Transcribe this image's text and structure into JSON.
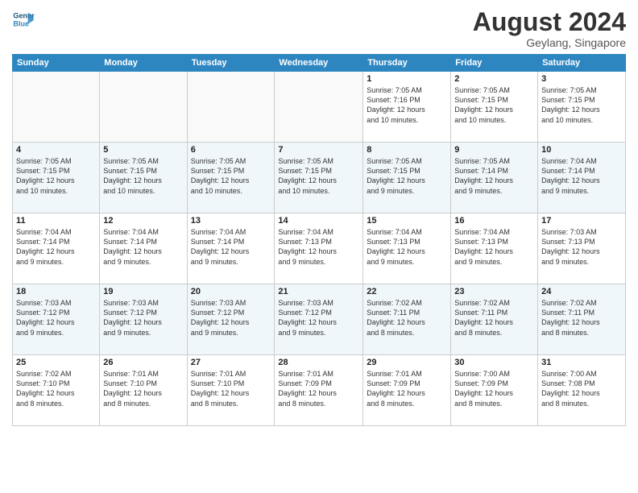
{
  "logo": {
    "line1": "General",
    "line2": "Blue"
  },
  "title": "August 2024",
  "subtitle": "Geylang, Singapore",
  "headers": [
    "Sunday",
    "Monday",
    "Tuesday",
    "Wednesday",
    "Thursday",
    "Friday",
    "Saturday"
  ],
  "weeks": [
    [
      {
        "day": "",
        "info": ""
      },
      {
        "day": "",
        "info": ""
      },
      {
        "day": "",
        "info": ""
      },
      {
        "day": "",
        "info": ""
      },
      {
        "day": "1",
        "info": "Sunrise: 7:05 AM\nSunset: 7:16 PM\nDaylight: 12 hours\nand 10 minutes."
      },
      {
        "day": "2",
        "info": "Sunrise: 7:05 AM\nSunset: 7:15 PM\nDaylight: 12 hours\nand 10 minutes."
      },
      {
        "day": "3",
        "info": "Sunrise: 7:05 AM\nSunset: 7:15 PM\nDaylight: 12 hours\nand 10 minutes."
      }
    ],
    [
      {
        "day": "4",
        "info": "Sunrise: 7:05 AM\nSunset: 7:15 PM\nDaylight: 12 hours\nand 10 minutes."
      },
      {
        "day": "5",
        "info": "Sunrise: 7:05 AM\nSunset: 7:15 PM\nDaylight: 12 hours\nand 10 minutes."
      },
      {
        "day": "6",
        "info": "Sunrise: 7:05 AM\nSunset: 7:15 PM\nDaylight: 12 hours\nand 10 minutes."
      },
      {
        "day": "7",
        "info": "Sunrise: 7:05 AM\nSunset: 7:15 PM\nDaylight: 12 hours\nand 10 minutes."
      },
      {
        "day": "8",
        "info": "Sunrise: 7:05 AM\nSunset: 7:15 PM\nDaylight: 12 hours\nand 9 minutes."
      },
      {
        "day": "9",
        "info": "Sunrise: 7:05 AM\nSunset: 7:14 PM\nDaylight: 12 hours\nand 9 minutes."
      },
      {
        "day": "10",
        "info": "Sunrise: 7:04 AM\nSunset: 7:14 PM\nDaylight: 12 hours\nand 9 minutes."
      }
    ],
    [
      {
        "day": "11",
        "info": "Sunrise: 7:04 AM\nSunset: 7:14 PM\nDaylight: 12 hours\nand 9 minutes."
      },
      {
        "day": "12",
        "info": "Sunrise: 7:04 AM\nSunset: 7:14 PM\nDaylight: 12 hours\nand 9 minutes."
      },
      {
        "day": "13",
        "info": "Sunrise: 7:04 AM\nSunset: 7:14 PM\nDaylight: 12 hours\nand 9 minutes."
      },
      {
        "day": "14",
        "info": "Sunrise: 7:04 AM\nSunset: 7:13 PM\nDaylight: 12 hours\nand 9 minutes."
      },
      {
        "day": "15",
        "info": "Sunrise: 7:04 AM\nSunset: 7:13 PM\nDaylight: 12 hours\nand 9 minutes."
      },
      {
        "day": "16",
        "info": "Sunrise: 7:04 AM\nSunset: 7:13 PM\nDaylight: 12 hours\nand 9 minutes."
      },
      {
        "day": "17",
        "info": "Sunrise: 7:03 AM\nSunset: 7:13 PM\nDaylight: 12 hours\nand 9 minutes."
      }
    ],
    [
      {
        "day": "18",
        "info": "Sunrise: 7:03 AM\nSunset: 7:12 PM\nDaylight: 12 hours\nand 9 minutes."
      },
      {
        "day": "19",
        "info": "Sunrise: 7:03 AM\nSunset: 7:12 PM\nDaylight: 12 hours\nand 9 minutes."
      },
      {
        "day": "20",
        "info": "Sunrise: 7:03 AM\nSunset: 7:12 PM\nDaylight: 12 hours\nand 9 minutes."
      },
      {
        "day": "21",
        "info": "Sunrise: 7:03 AM\nSunset: 7:12 PM\nDaylight: 12 hours\nand 9 minutes."
      },
      {
        "day": "22",
        "info": "Sunrise: 7:02 AM\nSunset: 7:11 PM\nDaylight: 12 hours\nand 8 minutes."
      },
      {
        "day": "23",
        "info": "Sunrise: 7:02 AM\nSunset: 7:11 PM\nDaylight: 12 hours\nand 8 minutes."
      },
      {
        "day": "24",
        "info": "Sunrise: 7:02 AM\nSunset: 7:11 PM\nDaylight: 12 hours\nand 8 minutes."
      }
    ],
    [
      {
        "day": "25",
        "info": "Sunrise: 7:02 AM\nSunset: 7:10 PM\nDaylight: 12 hours\nand 8 minutes."
      },
      {
        "day": "26",
        "info": "Sunrise: 7:01 AM\nSunset: 7:10 PM\nDaylight: 12 hours\nand 8 minutes."
      },
      {
        "day": "27",
        "info": "Sunrise: 7:01 AM\nSunset: 7:10 PM\nDaylight: 12 hours\nand 8 minutes."
      },
      {
        "day": "28",
        "info": "Sunrise: 7:01 AM\nSunset: 7:09 PM\nDaylight: 12 hours\nand 8 minutes."
      },
      {
        "day": "29",
        "info": "Sunrise: 7:01 AM\nSunset: 7:09 PM\nDaylight: 12 hours\nand 8 minutes."
      },
      {
        "day": "30",
        "info": "Sunrise: 7:00 AM\nSunset: 7:09 PM\nDaylight: 12 hours\nand 8 minutes."
      },
      {
        "day": "31",
        "info": "Sunrise: 7:00 AM\nSunset: 7:08 PM\nDaylight: 12 hours\nand 8 minutes."
      }
    ]
  ]
}
